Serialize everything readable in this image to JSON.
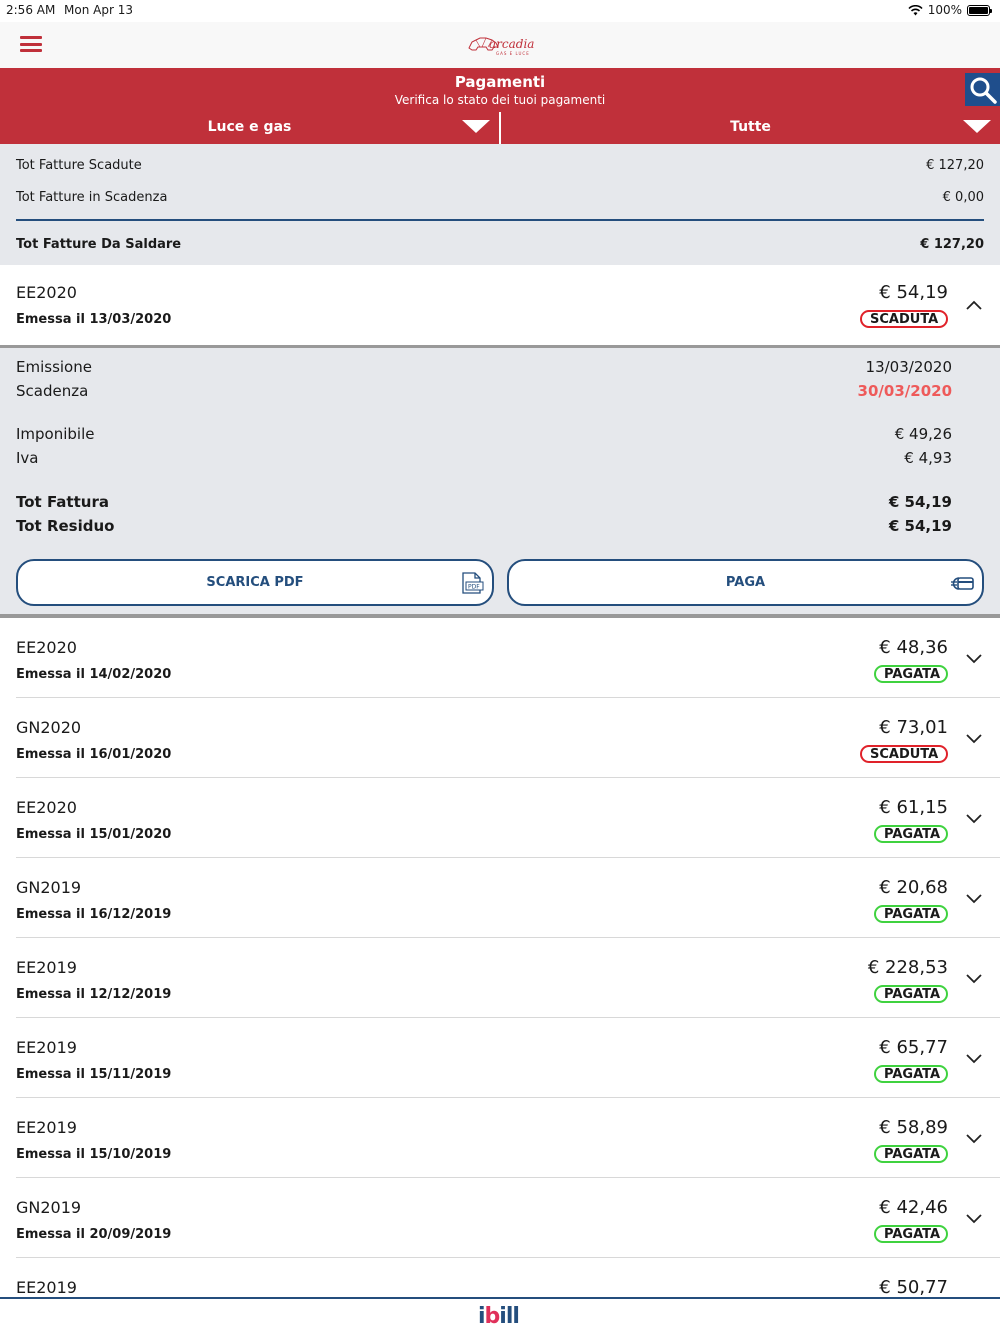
{
  "status_bar": {
    "time": "2:56 AM",
    "date": "Mon Apr 13",
    "battery": "100%"
  },
  "navbar": {
    "logo_text": "arcadia",
    "logo_sub": "GAS E LUCE"
  },
  "header": {
    "title": "Pagamenti",
    "subtitle": "Verifica lo stato dei tuoi pagamenti",
    "filter_left": "Luce e gas",
    "filter_right": "Tutte"
  },
  "summary": {
    "scadute_label": "Tot Fatture Scadute",
    "scadute_value": "€ 127,20",
    "in_scadenza_label": "Tot Fatture in Scadenza",
    "in_scadenza_value": "€ 0,00",
    "da_saldare_label": "Tot Fatture Da Saldare",
    "da_saldare_value": "€ 127,20"
  },
  "expanded": {
    "code": "EE2020",
    "date": "Emessa il 13/03/2020",
    "amount": "€ 54,19",
    "status": "SCADUTA",
    "emissione_label": "Emissione",
    "emissione_value": "13/03/2020",
    "scadenza_label": "Scadenza",
    "scadenza_value": "30/03/2020",
    "imponibile_label": "Imponibile",
    "imponibile_value": "€ 49,26",
    "iva_label": "Iva",
    "iva_value": "€ 4,93",
    "tot_fattura_label": "Tot Fattura",
    "tot_fattura_value": "€ 54,19",
    "tot_residuo_label": "Tot Residuo",
    "tot_residuo_value": "€ 54,19",
    "btn_pdf": "SCARICA PDF",
    "btn_pay": "PAGA"
  },
  "invoices": [
    {
      "code": "EE2020",
      "date": "Emessa il 14/02/2020",
      "amount": "€ 48,36",
      "status": "PAGATA"
    },
    {
      "code": "GN2020",
      "date": "Emessa il 16/01/2020",
      "amount": "€ 73,01",
      "status": "SCADUTA"
    },
    {
      "code": "EE2020",
      "date": "Emessa il 15/01/2020",
      "amount": "€ 61,15",
      "status": "PAGATA"
    },
    {
      "code": "GN2019",
      "date": "Emessa il 16/12/2019",
      "amount": "€ 20,68",
      "status": "PAGATA"
    },
    {
      "code": "EE2019",
      "date": "Emessa il 12/12/2019",
      "amount": "€ 228,53",
      "status": "PAGATA"
    },
    {
      "code": "EE2019",
      "date": "Emessa il 15/11/2019",
      "amount": "€ 65,77",
      "status": "PAGATA"
    },
    {
      "code": "EE2019",
      "date": "Emessa il 15/10/2019",
      "amount": "€ 58,89",
      "status": "PAGATA"
    },
    {
      "code": "GN2019",
      "date": "Emessa il 20/09/2019",
      "amount": "€ 42,46",
      "status": "PAGATA"
    },
    {
      "code": "EE2019",
      "date": "",
      "amount": "€ 50,77",
      "status": ""
    }
  ],
  "footer": {
    "brand_a": "i",
    "brand_b": "b",
    "brand_c": "ill"
  },
  "colors": {
    "primary_red": "#c0303a",
    "primary_blue": "#244e7d",
    "overdue": "#e0222a",
    "paid": "#3fd23f"
  }
}
